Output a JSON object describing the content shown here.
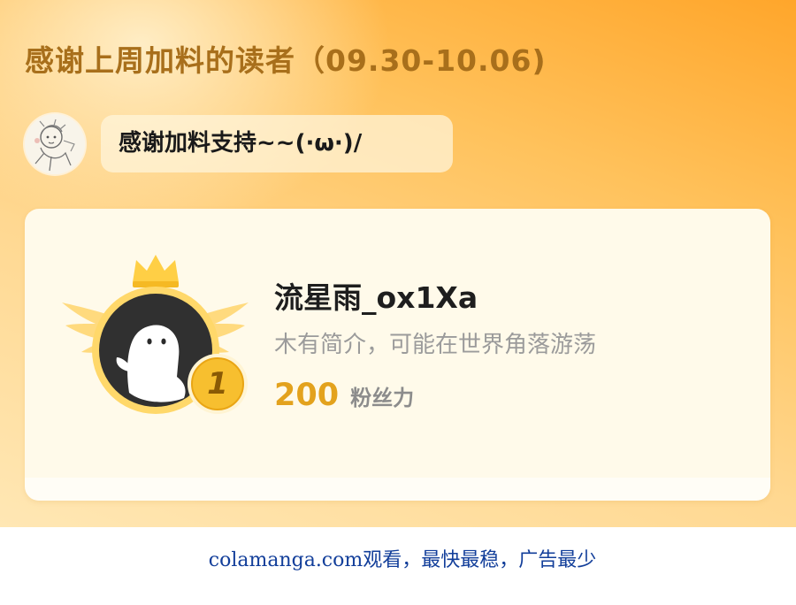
{
  "header": {
    "title": "感谢上周加料的读者（09.30-10.06)"
  },
  "author": {
    "avatar_icon": "sketch-avatar-icon",
    "message": "感谢加料支持~~(·ω·)/"
  },
  "top_supporter": {
    "rank": "1",
    "name": "流星雨_ox1Xa",
    "bio": "木有简介，可能在世界角落游荡",
    "score": "200",
    "score_unit": "粉丝力",
    "avatar_icon": "default-ghost-avatar-icon",
    "badge_icon": "crown-wings-badge-icon"
  },
  "footer": {
    "watermark": "colamanga.com观看，最快最稳，广告最少"
  },
  "colors": {
    "panel_orange": "#ffa62b",
    "title_brown": "#a86f1b",
    "score_gold": "#e3a21d",
    "footer_blue": "#123e9a"
  }
}
